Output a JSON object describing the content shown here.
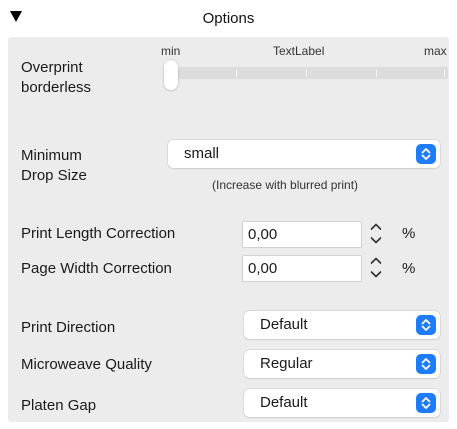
{
  "header": {
    "title": "Options"
  },
  "overprint": {
    "label_line1": "Overprint",
    "label_line2": "borderless",
    "slider_min": "min",
    "slider_label": "TextLabel",
    "slider_max": "max",
    "slider_value_fraction": 0.0
  },
  "drop_size": {
    "label_line1": "Minimum",
    "label_line2": "Drop Size",
    "selected": "small",
    "hint": "(Increase with blurred print)"
  },
  "print_length": {
    "label": "Print Length Correction",
    "value": "0,00",
    "unit": "%"
  },
  "page_width": {
    "label": "Page Width Correction",
    "value": "0,00",
    "unit": "%"
  },
  "print_direction": {
    "label": "Print Direction",
    "selected": "Default"
  },
  "microweave": {
    "label": "Microweave Quality",
    "selected": "Regular"
  },
  "platen_gap": {
    "label": "Platen Gap",
    "selected": "Default"
  },
  "colors": {
    "accent": "#1f7bff",
    "panel": "#ececec"
  },
  "icons": {
    "disclosure": "disclosure-triangle-icon",
    "popup": "up-down-chevron-icon",
    "stepper": "stepper-arrows-icon"
  }
}
